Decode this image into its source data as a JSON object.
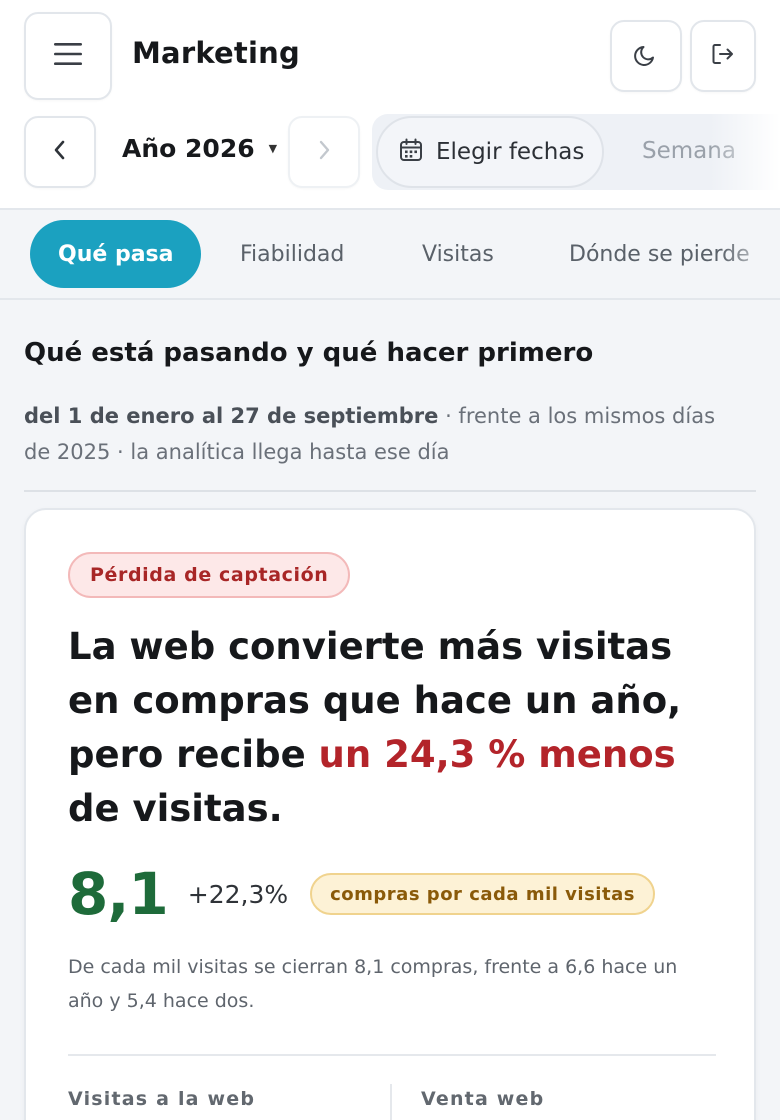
{
  "header": {
    "title": "Marketing",
    "year_label": "Año 2026",
    "pick_dates_label": "Elegir fechas",
    "week_option": "Semana"
  },
  "icons": {
    "menu": "menu-icon",
    "theme": "moon-icon",
    "logout": "logout-icon",
    "prev": "chevron-left-icon",
    "next": "chevron-right-icon",
    "calendar": "calendar-icon",
    "caret": "caret-down-icon"
  },
  "tabs": [
    {
      "label": "Qué pasa",
      "active": true
    },
    {
      "label": "Fiabilidad",
      "active": false
    },
    {
      "label": "Visitas",
      "active": false
    },
    {
      "label": "Dónde se pierde",
      "active": false
    }
  ],
  "section": {
    "title": "Qué está pasando y qué hacer primero",
    "period_strong": "del 1 de enero al 27 de septiembre",
    "period_rest": " · frente a los mismos días de 2025 · la analítica llega hasta ese día"
  },
  "card": {
    "badge": "Pérdida de captación",
    "headline_start": "La web convierte más visitas en compras que hace un año, pero recibe ",
    "headline_highlight": "un 24,3 % menos",
    "headline_end": " de visitas.",
    "metric_value": "8,1",
    "metric_change": "+22,3%",
    "metric_pill": "compras por cada mil visitas",
    "metric_description": "De cada mil visitas se cierran 8,1 compras, frente a 6,6 hace un año y 5,4 hace dos.",
    "kpi_left_label": "Visitas a la web",
    "kpi_right_label": "Venta web"
  },
  "colors": {
    "accent": "#1ba1c0",
    "loss_red": "#b3242a",
    "positive_green": "#1e6b3a",
    "pill_amber": "#fdf2d6"
  }
}
